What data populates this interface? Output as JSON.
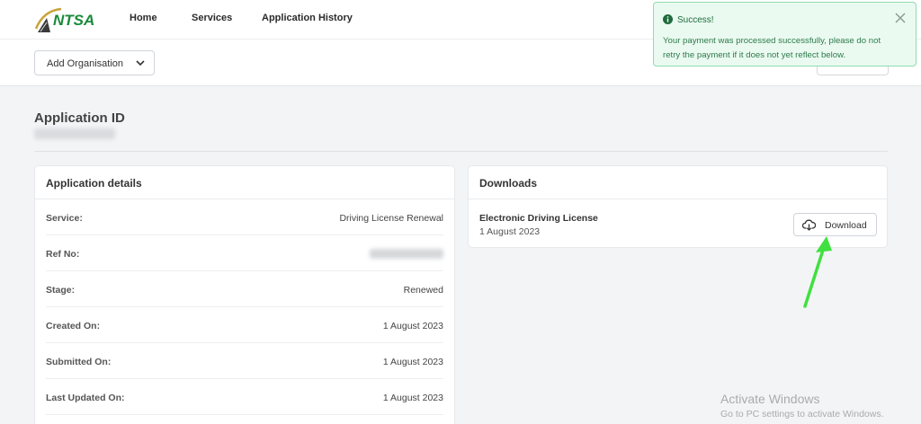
{
  "nav": {
    "logo_text": "NTSA",
    "items": [
      {
        "label": "Home"
      },
      {
        "label": "Services"
      },
      {
        "label": "Application History"
      }
    ]
  },
  "toolbar": {
    "org_select_value": "Add Organisation"
  },
  "toast": {
    "title": "Success!",
    "message": "Your payment was processed successfully, please do not retry the payment if it does not yet reflect below."
  },
  "application": {
    "id_label": "Application ID",
    "id_value": "████ ████████"
  },
  "details": {
    "title": "Application details",
    "rows": [
      {
        "label": "Service:",
        "value": "Driving License Renewal"
      },
      {
        "label": "Ref No:",
        "value": "████ ████ ██████"
      },
      {
        "label": "Stage:",
        "value": "Renewed"
      },
      {
        "label": "Created On:",
        "value": "1 August 2023"
      },
      {
        "label": "Submitted On:",
        "value": "1 August 2023"
      },
      {
        "label": "Last Updated On:",
        "value": "1 August 2023"
      }
    ]
  },
  "downloads": {
    "title": "Downloads",
    "items": [
      {
        "name": "Electronic Driving License",
        "date": "1 August 2023",
        "button_label": "Download"
      }
    ]
  },
  "watermark": {
    "line1": "Activate Windows",
    "line2": "Go to PC settings to activate Windows."
  },
  "colors": {
    "success_bg": "#eafaf0",
    "success_border": "#8fdcb1",
    "success_text": "#1f6b3d",
    "annotation_arrow": "#3fe03f",
    "logo_brand": "#1a8a3a"
  }
}
